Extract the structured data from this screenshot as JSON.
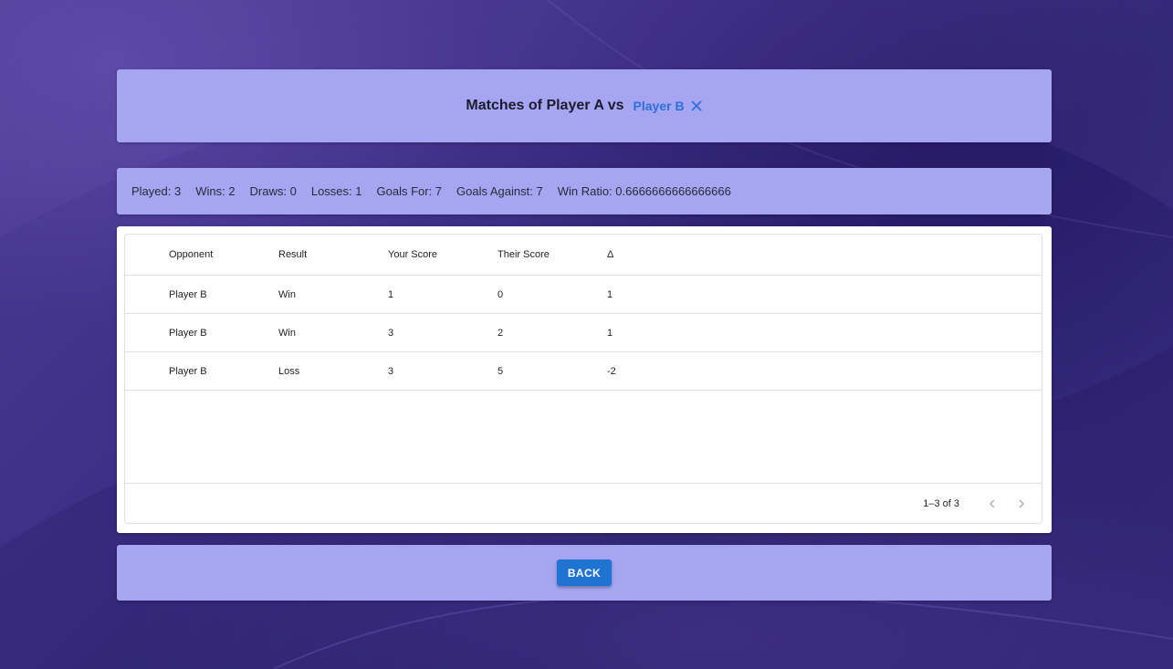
{
  "header": {
    "title": "Matches of Player A vs",
    "opponent_chip": "Player B"
  },
  "stats": {
    "played": "Played: 3",
    "wins": "Wins: 2",
    "draws": "Draws: 0",
    "losses": "Losses: 1",
    "goals_for": "Goals For: 7",
    "goals_against": "Goals Against: 7",
    "win_ratio": "Win Ratio: 0.6666666666666666"
  },
  "table": {
    "columns": [
      "Opponent",
      "Result",
      "Your Score",
      "Their Score",
      "Δ"
    ],
    "rows": [
      [
        "Player B",
        "Win",
        "1",
        "0",
        "1"
      ],
      [
        "Player B",
        "Win",
        "3",
        "2",
        "1"
      ],
      [
        "Player B",
        "Loss",
        "3",
        "5",
        "-2"
      ]
    ],
    "pagination": "1–3 of 3"
  },
  "footer": {
    "back_label": "BACK"
  },
  "colors": {
    "card": "#a5a5f2",
    "accent": "#1f74d2",
    "chip_text": "#2f6fd6"
  },
  "icons": {
    "chip_close": "close-icon",
    "prev": "chevron-left-icon",
    "next": "chevron-right-icon"
  }
}
